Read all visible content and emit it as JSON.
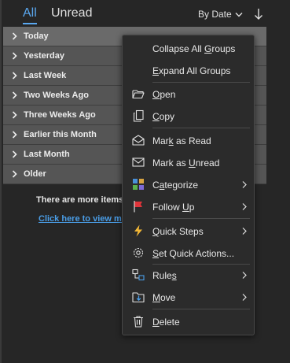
{
  "tabs": {
    "all": "All",
    "unread": "Unread"
  },
  "sort": {
    "label": "By Date"
  },
  "groups": [
    "Today",
    "Yesterday",
    "Last Week",
    "Two Weeks Ago",
    "Three Weeks Ago",
    "Earlier this Month",
    "Last Month",
    "Older"
  ],
  "more": {
    "text": "There are more items",
    "link": "Click here to view mo"
  },
  "menu": {
    "collapse_pre": "Collapse All ",
    "collapse_u": "G",
    "collapse_post": "roups",
    "expand_pre": "",
    "expand_u": "E",
    "expand_post": "xpand All Groups",
    "open_pre": "",
    "open_u": "O",
    "open_post": "pen",
    "copy_pre": "",
    "copy_u": "C",
    "copy_post": "opy",
    "read_pre": "Mar",
    "read_u": "k",
    "read_post": " as Read",
    "unread_pre": "Mark as ",
    "unread_u": "U",
    "unread_post": "nread",
    "categorize_pre": "C",
    "categorize_u": "a",
    "categorize_post": "tegorize",
    "follow_pre": "Follow ",
    "follow_u": "U",
    "follow_post": "p",
    "quicksteps_pre": "",
    "quicksteps_u": "Q",
    "quicksteps_post": "uick Steps",
    "setquick_pre": "",
    "setquick_u": "S",
    "setquick_post": "et Quick Actions...",
    "rules_pre": "Rule",
    "rules_u": "s",
    "rules_post": "",
    "move_pre": "",
    "move_u": "M",
    "move_post": "ove",
    "delete_pre": "",
    "delete_u": "D",
    "delete_post": "elete"
  },
  "colors": {
    "accent": "#5aa8f0",
    "link": "#4a9ee8",
    "group_row": "#555555"
  }
}
